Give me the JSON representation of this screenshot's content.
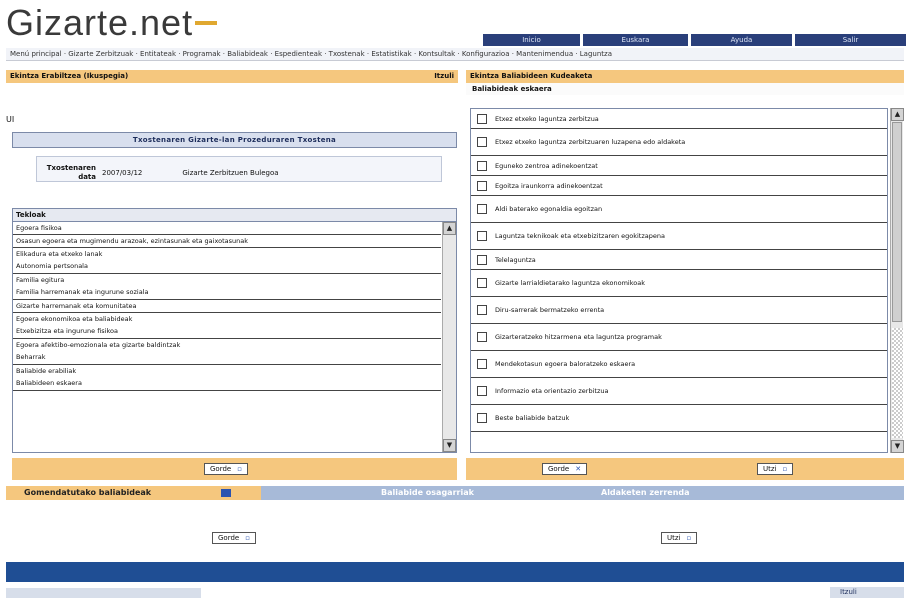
{
  "logo": {
    "text": "Gizarte.net"
  },
  "topnav": [
    "Inicio",
    "Euskara",
    "Ayuda",
    "Salir"
  ],
  "site_menu": "Menú principal · Gizarte Zerbitzuak · Entitateak · Programak · Baliabideak · Espedienteak · Txostenak · Estatistikak · Kontsultak · Konfigurazioa · Mantenimendua · Laguntza",
  "left_panel": {
    "header_left": "Ekintza Erabiltzea (Ikuspegia)",
    "header_right": "Itzuli",
    "mark": "UI",
    "title": "Txostenaren Gizarte-lan Prozeduraren Txostena",
    "date_label": "Txostenaren data",
    "date_value": "2007/03/12",
    "location_value": "Gizarte Zerbitzuen Bulegoa",
    "list_header": "Tekloak",
    "items": [
      "Egoera fisikoa",
      "Osasun egoera eta mugimendu arazoak, ezintasunak eta gaixotasunak",
      "Elikadura eta etxeko lanak",
      "Autonomia pertsonala",
      "Familia egitura",
      "Familia harremanak eta ingurune soziala",
      "Gizarte harremanak eta komunitatea",
      "Egoera ekonomikoa eta baliabideak",
      "Etxebizitza eta ingurune fisikoa",
      "Egoera afektibo-emozionala eta gizarte baldintzak",
      "Beharrak",
      "Baliabide erabiliak",
      "Baliabideen eskaera"
    ],
    "accept_button": "Gorde"
  },
  "right_panel": {
    "title": "Ekintza Baliabideen Kudeaketa",
    "subtitle": "Baliabideak eskaera",
    "items": [
      "Etxez etxeko laguntza zerbitzua",
      "Etxez etxeko laguntza zerbitzuaren luzapena edo aldaketa",
      "Eguneko zentroa adinekoentzat",
      "Egoitza iraunkorra adinekoentzat",
      "Aldi baterako egonaldia egoitzan",
      "Laguntza teknikoak eta etxebizitzaren egokitzapena",
      "Telelaguntza",
      "Gizarte larrialdietarako laguntza ekonomikoak",
      "Diru-sarrerak bermatzeko errenta",
      "Gizarteratzeko hitzarmena eta laguntza programak",
      "Mendekotasun egoera baloratzeko eskaera",
      "Informazio eta orientazio zerbitzua",
      "Beste baliabide batzuk"
    ],
    "save_button": "Gorde",
    "cancel_button": "Utzi"
  },
  "bottom": {
    "tab1": "Gomendatutako baliabideak",
    "tab2": "Baliabide osagarriak",
    "tab3": "Aldaketen zerrenda",
    "save_button": "Gorde",
    "cancel_button": "Utzi",
    "footer_right": "Itzuli"
  }
}
